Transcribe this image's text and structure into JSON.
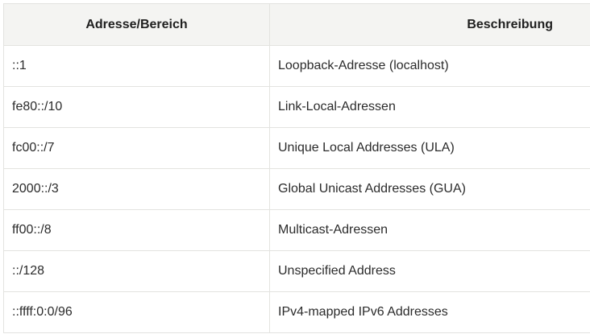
{
  "table": {
    "headers": [
      "Adresse/Bereich",
      "Beschreibung"
    ],
    "rows": [
      [
        "::1",
        "Loopback-Adresse (localhost)"
      ],
      [
        "fe80::/10",
        "Link-Local-Adressen"
      ],
      [
        "fc00::/7",
        "Unique Local Addresses (ULA)"
      ],
      [
        "2000::/3",
        "Global Unicast Addresses (GUA)"
      ],
      [
        "ff00::/8",
        "Multicast-Adressen"
      ],
      [
        "::/128",
        "Unspecified Address"
      ],
      [
        "::ffff:0:0/96",
        "IPv4-mapped IPv6 Addresses"
      ]
    ]
  }
}
